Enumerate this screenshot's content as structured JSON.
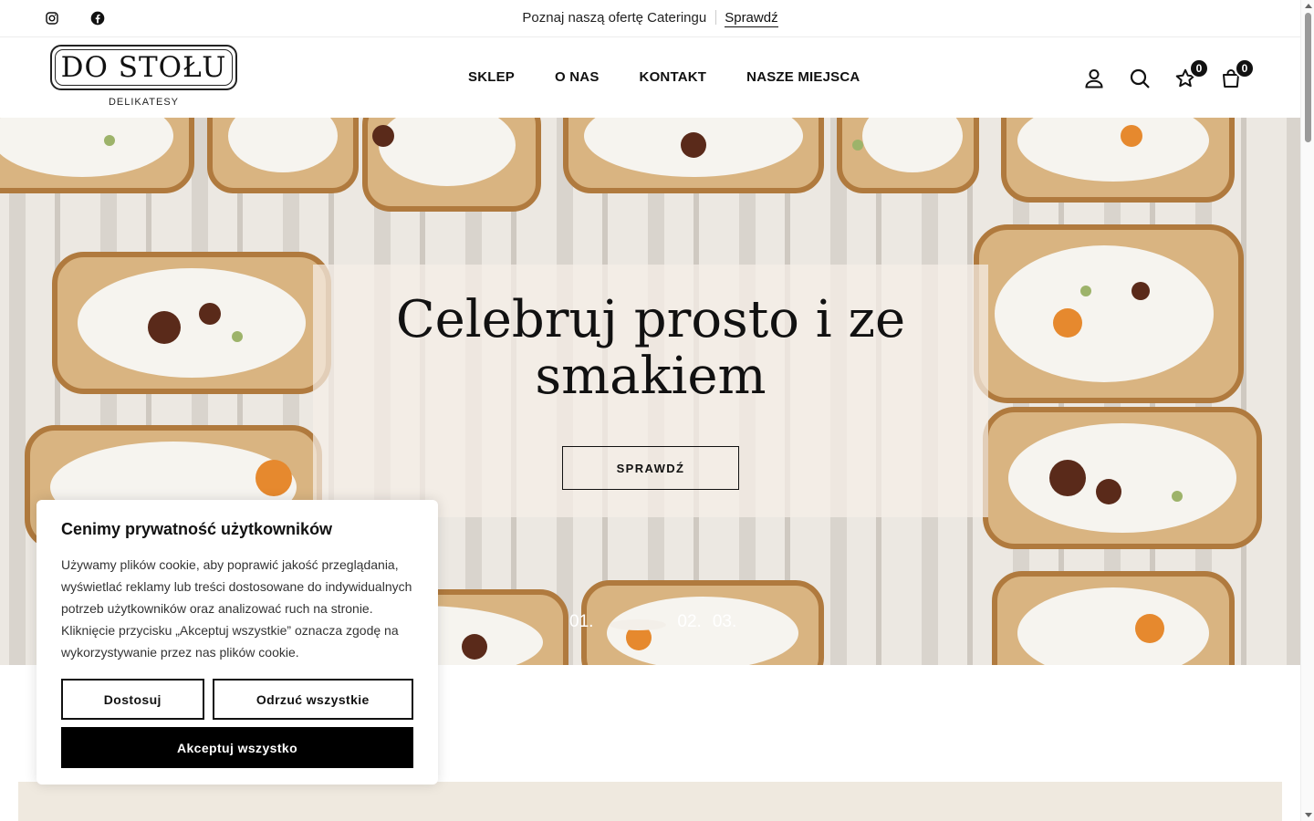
{
  "topbar": {
    "promo_text": "Poznaj naszą ofertę Cateringu",
    "promo_link": "Sprawdź"
  },
  "logo": {
    "title": "DO STOŁU",
    "subtitle": "DELIKATESY"
  },
  "nav": {
    "items": [
      {
        "label": "SKLEP"
      },
      {
        "label": "O NAS"
      },
      {
        "label": "KONTAKT"
      },
      {
        "label": "NASZE MIEJSCA"
      }
    ]
  },
  "header_icons": {
    "wishlist_count": "0",
    "cart_count": "0"
  },
  "hero": {
    "title": "Celebruj prosto i ze smakiem",
    "button_label": "SPRAWDŹ",
    "slides": [
      "01.",
      "02.",
      "03."
    ],
    "active_slide": 1
  },
  "cookie": {
    "title": "Cenimy prywatność użytkowników",
    "body": "Używamy plików cookie, aby poprawić jakość przeglądania, wyświetlać reklamy lub treści dostosowane do indywidualnych potrzeb użytkowników oraz analizować ruch na stronie. Kliknięcie przycisku „Akceptuj wszystkie” oznacza zgodę na wykorzystywanie przez nas plików cookie.",
    "customize_label": "Dostosuj",
    "reject_label": "Odrzuć wszystkie",
    "accept_label": "Akceptuj wszystko"
  },
  "colors": {
    "accent": "#000000",
    "hero_card": "#f5eee8",
    "strip": "#efe9df"
  }
}
